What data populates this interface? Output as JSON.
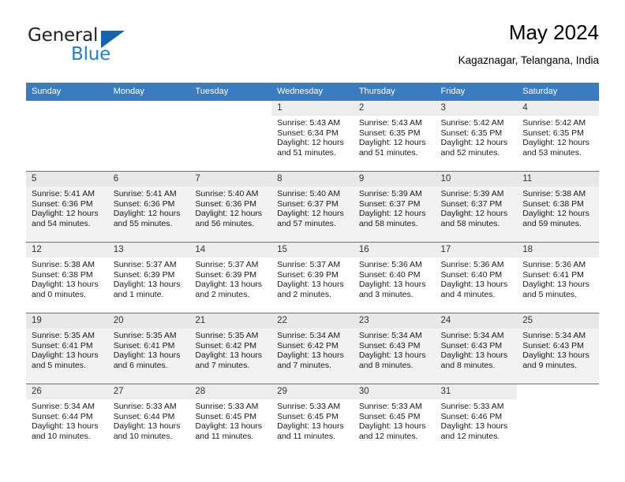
{
  "branding": {
    "logo_text_1": "General",
    "logo_text_2": "Blue",
    "logo_icon": "triangle-icon",
    "accent_color": "#1c7fd1",
    "header_color": "#3a7cbf"
  },
  "header": {
    "title": "May 2024",
    "subtitle": "Kagaznagar, Telangana, India"
  },
  "weekdays": [
    "Sunday",
    "Monday",
    "Tuesday",
    "Wednesday",
    "Thursday",
    "Friday",
    "Saturday"
  ],
  "weeks": [
    [
      {
        "day": "",
        "sunrise": "",
        "sunset": "",
        "daylight": "",
        "empty": true
      },
      {
        "day": "",
        "sunrise": "",
        "sunset": "",
        "daylight": "",
        "empty": true
      },
      {
        "day": "",
        "sunrise": "",
        "sunset": "",
        "daylight": "",
        "empty": true
      },
      {
        "day": "1",
        "sunrise": "Sunrise: 5:43 AM",
        "sunset": "Sunset: 6:34 PM",
        "daylight": "Daylight: 12 hours and 51 minutes."
      },
      {
        "day": "2",
        "sunrise": "Sunrise: 5:43 AM",
        "sunset": "Sunset: 6:35 PM",
        "daylight": "Daylight: 12 hours and 51 minutes."
      },
      {
        "day": "3",
        "sunrise": "Sunrise: 5:42 AM",
        "sunset": "Sunset: 6:35 PM",
        "daylight": "Daylight: 12 hours and 52 minutes."
      },
      {
        "day": "4",
        "sunrise": "Sunrise: 5:42 AM",
        "sunset": "Sunset: 6:35 PM",
        "daylight": "Daylight: 12 hours and 53 minutes."
      }
    ],
    [
      {
        "day": "5",
        "sunrise": "Sunrise: 5:41 AM",
        "sunset": "Sunset: 6:36 PM",
        "daylight": "Daylight: 12 hours and 54 minutes."
      },
      {
        "day": "6",
        "sunrise": "Sunrise: 5:41 AM",
        "sunset": "Sunset: 6:36 PM",
        "daylight": "Daylight: 12 hours and 55 minutes."
      },
      {
        "day": "7",
        "sunrise": "Sunrise: 5:40 AM",
        "sunset": "Sunset: 6:36 PM",
        "daylight": "Daylight: 12 hours and 56 minutes."
      },
      {
        "day": "8",
        "sunrise": "Sunrise: 5:40 AM",
        "sunset": "Sunset: 6:37 PM",
        "daylight": "Daylight: 12 hours and 57 minutes."
      },
      {
        "day": "9",
        "sunrise": "Sunrise: 5:39 AM",
        "sunset": "Sunset: 6:37 PM",
        "daylight": "Daylight: 12 hours and 58 minutes."
      },
      {
        "day": "10",
        "sunrise": "Sunrise: 5:39 AM",
        "sunset": "Sunset: 6:37 PM",
        "daylight": "Daylight: 12 hours and 58 minutes."
      },
      {
        "day": "11",
        "sunrise": "Sunrise: 5:38 AM",
        "sunset": "Sunset: 6:38 PM",
        "daylight": "Daylight: 12 hours and 59 minutes."
      }
    ],
    [
      {
        "day": "12",
        "sunrise": "Sunrise: 5:38 AM",
        "sunset": "Sunset: 6:38 PM",
        "daylight": "Daylight: 13 hours and 0 minutes."
      },
      {
        "day": "13",
        "sunrise": "Sunrise: 5:37 AM",
        "sunset": "Sunset: 6:39 PM",
        "daylight": "Daylight: 13 hours and 1 minute."
      },
      {
        "day": "14",
        "sunrise": "Sunrise: 5:37 AM",
        "sunset": "Sunset: 6:39 PM",
        "daylight": "Daylight: 13 hours and 2 minutes."
      },
      {
        "day": "15",
        "sunrise": "Sunrise: 5:37 AM",
        "sunset": "Sunset: 6:39 PM",
        "daylight": "Daylight: 13 hours and 2 minutes."
      },
      {
        "day": "16",
        "sunrise": "Sunrise: 5:36 AM",
        "sunset": "Sunset: 6:40 PM",
        "daylight": "Daylight: 13 hours and 3 minutes."
      },
      {
        "day": "17",
        "sunrise": "Sunrise: 5:36 AM",
        "sunset": "Sunset: 6:40 PM",
        "daylight": "Daylight: 13 hours and 4 minutes."
      },
      {
        "day": "18",
        "sunrise": "Sunrise: 5:36 AM",
        "sunset": "Sunset: 6:41 PM",
        "daylight": "Daylight: 13 hours and 5 minutes."
      }
    ],
    [
      {
        "day": "19",
        "sunrise": "Sunrise: 5:35 AM",
        "sunset": "Sunset: 6:41 PM",
        "daylight": "Daylight: 13 hours and 5 minutes."
      },
      {
        "day": "20",
        "sunrise": "Sunrise: 5:35 AM",
        "sunset": "Sunset: 6:41 PM",
        "daylight": "Daylight: 13 hours and 6 minutes."
      },
      {
        "day": "21",
        "sunrise": "Sunrise: 5:35 AM",
        "sunset": "Sunset: 6:42 PM",
        "daylight": "Daylight: 13 hours and 7 minutes."
      },
      {
        "day": "22",
        "sunrise": "Sunrise: 5:34 AM",
        "sunset": "Sunset: 6:42 PM",
        "daylight": "Daylight: 13 hours and 7 minutes."
      },
      {
        "day": "23",
        "sunrise": "Sunrise: 5:34 AM",
        "sunset": "Sunset: 6:43 PM",
        "daylight": "Daylight: 13 hours and 8 minutes."
      },
      {
        "day": "24",
        "sunrise": "Sunrise: 5:34 AM",
        "sunset": "Sunset: 6:43 PM",
        "daylight": "Daylight: 13 hours and 8 minutes."
      },
      {
        "day": "25",
        "sunrise": "Sunrise: 5:34 AM",
        "sunset": "Sunset: 6:43 PM",
        "daylight": "Daylight: 13 hours and 9 minutes."
      }
    ],
    [
      {
        "day": "26",
        "sunrise": "Sunrise: 5:34 AM",
        "sunset": "Sunset: 6:44 PM",
        "daylight": "Daylight: 13 hours and 10 minutes."
      },
      {
        "day": "27",
        "sunrise": "Sunrise: 5:33 AM",
        "sunset": "Sunset: 6:44 PM",
        "daylight": "Daylight: 13 hours and 10 minutes."
      },
      {
        "day": "28",
        "sunrise": "Sunrise: 5:33 AM",
        "sunset": "Sunset: 6:45 PM",
        "daylight": "Daylight: 13 hours and 11 minutes."
      },
      {
        "day": "29",
        "sunrise": "Sunrise: 5:33 AM",
        "sunset": "Sunset: 6:45 PM",
        "daylight": "Daylight: 13 hours and 11 minutes."
      },
      {
        "day": "30",
        "sunrise": "Sunrise: 5:33 AM",
        "sunset": "Sunset: 6:45 PM",
        "daylight": "Daylight: 13 hours and 12 minutes."
      },
      {
        "day": "31",
        "sunrise": "Sunrise: 5:33 AM",
        "sunset": "Sunset: 6:46 PM",
        "daylight": "Daylight: 13 hours and 12 minutes."
      },
      {
        "day": "",
        "sunrise": "",
        "sunset": "",
        "daylight": "",
        "empty": true
      }
    ]
  ]
}
